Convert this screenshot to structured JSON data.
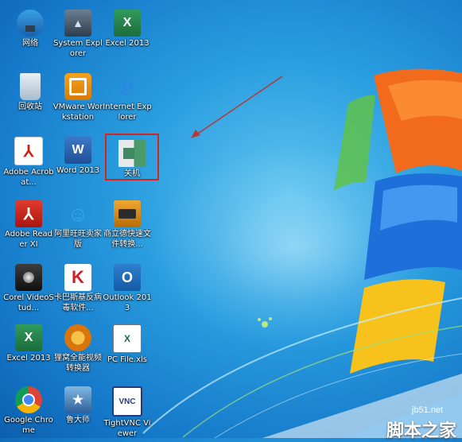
{
  "desktop": {
    "icons": [
      {
        "id": "network",
        "label": "网络",
        "icon": "network-icon",
        "glyph": ""
      },
      {
        "id": "system-explorer",
        "label": "System Explorer",
        "icon": "system-explorer-icon",
        "glyph": ""
      },
      {
        "id": "excel-2013-top",
        "label": "Excel 2013",
        "icon": "excel-icon",
        "glyph": "X"
      },
      {
        "id": "recycle-bin",
        "label": "回收站",
        "icon": "recycle-bin-icon",
        "glyph": ""
      },
      {
        "id": "vmware",
        "label": "VMware Workstation",
        "icon": "vmware-icon",
        "glyph": ""
      },
      {
        "id": "internet-explorer",
        "label": "Internet Explorer",
        "icon": "internet-explorer-icon",
        "glyph": "e"
      },
      {
        "id": "adobe-acrobat",
        "label": "Adobe Acrobat...",
        "icon": "adobe-acrobat-icon",
        "glyph": "⅄"
      },
      {
        "id": "word-2013",
        "label": "Word 2013",
        "icon": "word-icon",
        "glyph": "W"
      },
      {
        "id": "shutdown",
        "label": "关机",
        "icon": "shutdown-shortcut-icon",
        "glyph": ""
      },
      {
        "id": "adobe-reader",
        "label": "Adobe Reader XI",
        "icon": "adobe-reader-icon",
        "glyph": "⅄"
      },
      {
        "id": "aliwangwang",
        "label": "阿里旺旺卖家版",
        "icon": "aliwangwang-icon",
        "glyph": "☺"
      },
      {
        "id": "bianli",
        "label": "商立德快速文件转换...",
        "icon": "truck-icon",
        "glyph": ""
      },
      {
        "id": "corel",
        "label": "Corel VideoStud...",
        "icon": "corel-videostudio-icon",
        "glyph": ""
      },
      {
        "id": "kaspersky",
        "label": "卡巴斯基反病毒软件...",
        "icon": "kaspersky-icon",
        "glyph": "K"
      },
      {
        "id": "outlook-2013",
        "label": "Outlook 2013",
        "icon": "outlook-icon",
        "glyph": "O"
      },
      {
        "id": "excel-2013-bottom",
        "label": "Excel 2013",
        "icon": "excel-icon",
        "glyph": "X"
      },
      {
        "id": "format-factory",
        "label": "狸窝全能视频转换器",
        "icon": "video-converter-icon",
        "glyph": ""
      },
      {
        "id": "pc-file",
        "label": "PC File.xls",
        "icon": "xls-file-icon",
        "glyph": "X"
      },
      {
        "id": "chrome",
        "label": "Google Chrome",
        "icon": "chrome-icon",
        "glyph": ""
      },
      {
        "id": "hero",
        "label": "鲁大师",
        "icon": "ludashi-icon",
        "glyph": ""
      },
      {
        "id": "tightvnc",
        "label": "TightVNC Viewer",
        "icon": "vnc-icon",
        "glyph": "VNC"
      }
    ]
  },
  "watermark": {
    "site": "jb51.net",
    "name": "脚本之家"
  },
  "colors": {
    "highlight": "#d8231a",
    "arrow": "#b03a3a"
  }
}
